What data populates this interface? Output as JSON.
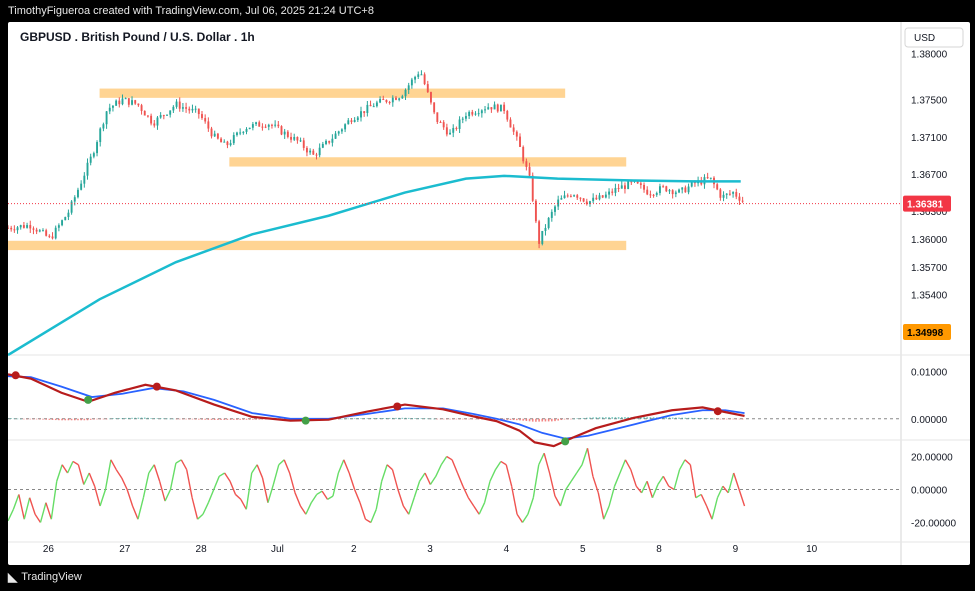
{
  "header": {
    "attribution": "TimothyFigueroa created with TradingView.com, Jul 06, 2025 21:24 UTC+8"
  },
  "footer": {
    "logo_text": "TradingView"
  },
  "colors": {
    "up": "#26a69a",
    "down": "#ef5350",
    "ma": "#1bbccf",
    "zone": "#ffcc80",
    "macd_fast": "#b71c1c",
    "macd_slow": "#2962ff",
    "macd_cross_up": "#43a047",
    "osc_up": "#66dd66",
    "osc_down": "#ef5350",
    "price_label": "#f23645",
    "marker_label": "#ff9800"
  },
  "chart_data": {
    "type": "candlestick",
    "title": "GBPUSD . British Pound / U.S. Dollar . 1h",
    "currency": "USD",
    "price_axis": {
      "ticks": [
        "1.38000",
        "1.37500",
        "1.37100",
        "1.36700",
        "1.36300",
        "1.36000",
        "1.35700",
        "1.35400"
      ],
      "ylim": [
        1.3475,
        1.381
      ]
    },
    "x_axis": {
      "labels": [
        "26",
        "27",
        "28",
        "Jul",
        "2",
        "3",
        "4",
        "5",
        "8",
        "9",
        "10"
      ],
      "day_range": [
        25.3,
        37.0
      ]
    },
    "last_price": "1.36381",
    "marker_price": "1.34998",
    "moving_average": {
      "points": [
        [
          25.3,
          1.3475
        ],
        [
          26.5,
          1.3535
        ],
        [
          27.5,
          1.3575
        ],
        [
          28.5,
          1.3605
        ],
        [
          29.5,
          1.3625
        ],
        [
          30.5,
          1.365
        ],
        [
          31.3,
          1.3665
        ],
        [
          31.8,
          1.3668
        ],
        [
          32.5,
          1.3665
        ],
        [
          33.5,
          1.3663
        ],
        [
          34.3,
          1.3662
        ],
        [
          34.9,
          1.3662
        ]
      ]
    },
    "zones": [
      {
        "from_day": 26.5,
        "to_day": 32.6,
        "low": 1.3752,
        "high": 1.3762
      },
      {
        "from_day": 28.2,
        "to_day": 33.4,
        "low": 1.3678,
        "high": 1.3688
      },
      {
        "from_day": 25.3,
        "to_day": 33.4,
        "low": 1.3588,
        "high": 1.3598
      }
    ],
    "price_anchors": [
      [
        25.3,
        1.3612
      ],
      [
        25.6,
        1.3615
      ],
      [
        25.85,
        1.36
      ],
      [
        26.1,
        1.363
      ],
      [
        26.4,
        1.369
      ],
      [
        26.6,
        1.374
      ],
      [
        26.8,
        1.375
      ],
      [
        27.0,
        1.3745
      ],
      [
        27.2,
        1.3725
      ],
      [
        27.5,
        1.3745
      ],
      [
        27.8,
        1.3735
      ],
      [
        28.0,
        1.371
      ],
      [
        28.15,
        1.37
      ],
      [
        28.4,
        1.372
      ],
      [
        28.7,
        1.3725
      ],
      [
        28.9,
        1.3715
      ],
      [
        29.1,
        1.3705
      ],
      [
        29.3,
        1.369
      ],
      [
        29.5,
        1.3705
      ],
      [
        29.8,
        1.373
      ],
      [
        30.1,
        1.3745
      ],
      [
        30.45,
        1.3755
      ],
      [
        30.7,
        1.3782
      ],
      [
        30.9,
        1.373
      ],
      [
        31.1,
        1.3712
      ],
      [
        31.3,
        1.3735
      ],
      [
        31.6,
        1.3743
      ],
      [
        31.8,
        1.374
      ],
      [
        32.0,
        1.37
      ],
      [
        32.15,
        1.366
      ],
      [
        32.25,
        1.3595
      ],
      [
        32.35,
        1.3615
      ],
      [
        32.5,
        1.364
      ],
      [
        32.7,
        1.365
      ],
      [
        32.9,
        1.364
      ],
      [
        33.1,
        1.3645
      ],
      [
        33.3,
        1.3655
      ],
      [
        33.5,
        1.366
      ],
      [
        33.7,
        1.365
      ],
      [
        33.9,
        1.3655
      ],
      [
        34.1,
        1.365
      ],
      [
        34.3,
        1.366
      ],
      [
        34.5,
        1.3665
      ],
      [
        34.65,
        1.3645
      ],
      [
        34.8,
        1.365
      ],
      [
        34.95,
        1.364
      ]
    ],
    "macd": {
      "ticks": [
        "0.01000",
        "0.00000"
      ],
      "ylim": [
        -0.0045,
        0.0135
      ],
      "fast": [
        [
          25.3,
          0.0094
        ],
        [
          25.6,
          0.0085
        ],
        [
          26.0,
          0.0055
        ],
        [
          26.35,
          0.0036
        ],
        [
          26.7,
          0.0055
        ],
        [
          27.1,
          0.0072
        ],
        [
          27.5,
          0.006
        ],
        [
          28.0,
          0.003
        ],
        [
          28.5,
          0.0004
        ],
        [
          29.0,
          -0.0004
        ],
        [
          29.5,
          -0.0002
        ],
        [
          30.0,
          0.0015
        ],
        [
          30.5,
          0.003
        ],
        [
          31.0,
          0.002
        ],
        [
          31.4,
          0.0005
        ],
        [
          31.7,
          -0.0005
        ],
        [
          32.0,
          -0.0025
        ],
        [
          32.2,
          -0.005
        ],
        [
          32.45,
          -0.0058
        ],
        [
          32.7,
          -0.004
        ],
        [
          33.0,
          -0.002
        ],
        [
          33.5,
          0.0002
        ],
        [
          34.0,
          0.0018
        ],
        [
          34.4,
          0.0024
        ],
        [
          34.7,
          0.0014
        ],
        [
          34.95,
          0.0006
        ]
      ],
      "slow": [
        [
          25.3,
          0.009
        ],
        [
          25.6,
          0.0088
        ],
        [
          26.0,
          0.0068
        ],
        [
          26.4,
          0.0046
        ],
        [
          26.8,
          0.0053
        ],
        [
          27.2,
          0.0065
        ],
        [
          27.6,
          0.0058
        ],
        [
          28.0,
          0.004
        ],
        [
          28.5,
          0.0012
        ],
        [
          29.0,
          0.0
        ],
        [
          29.5,
          0.0
        ],
        [
          30.0,
          0.001
        ],
        [
          30.5,
          0.0022
        ],
        [
          31.0,
          0.0022
        ],
        [
          31.4,
          0.001
        ],
        [
          31.7,
          0.0
        ],
        [
          32.0,
          -0.0012
        ],
        [
          32.3,
          -0.003
        ],
        [
          32.6,
          -0.0042
        ],
        [
          32.9,
          -0.0036
        ],
        [
          33.2,
          -0.0024
        ],
        [
          33.6,
          -0.0008
        ],
        [
          34.0,
          0.0008
        ],
        [
          34.4,
          0.0018
        ],
        [
          34.7,
          0.0018
        ],
        [
          34.95,
          0.0012
        ]
      ],
      "crosses": [
        {
          "day": 25.4,
          "value": 0.0092,
          "kind": "down"
        },
        {
          "day": 26.35,
          "value": 0.004,
          "kind": "up"
        },
        {
          "day": 27.25,
          "value": 0.0068,
          "kind": "down"
        },
        {
          "day": 29.2,
          "value": -0.0004,
          "kind": "up"
        },
        {
          "day": 30.4,
          "value": 0.0026,
          "kind": "down"
        },
        {
          "day": 32.6,
          "value": -0.0048,
          "kind": "up"
        },
        {
          "day": 34.6,
          "value": 0.0016,
          "kind": "down"
        }
      ]
    },
    "oscillator": {
      "ticks": [
        "20.00000",
        "0.00000",
        "-20.00000"
      ],
      "ylim": [
        -30,
        30
      ],
      "values": [
        -19,
        -12,
        -3,
        -18,
        -5,
        -15,
        -20,
        -8,
        -18,
        5,
        15,
        10,
        17,
        15,
        3,
        10,
        2,
        -10,
        0,
        18,
        12,
        7,
        0,
        -10,
        -18,
        -5,
        10,
        15,
        5,
        -7,
        0,
        16,
        18,
        12,
        -5,
        -18,
        -15,
        -8,
        0,
        8,
        10,
        5,
        -3,
        -6,
        -12,
        10,
        15,
        7,
        -8,
        3,
        15,
        18,
        10,
        -2,
        -10,
        -15,
        -8,
        -3,
        -1,
        -6,
        -4,
        10,
        18,
        10,
        0,
        -8,
        -18,
        -20,
        -12,
        5,
        15,
        12,
        0,
        -10,
        -15,
        -5,
        5,
        10,
        3,
        8,
        15,
        20,
        18,
        10,
        2,
        -5,
        -10,
        -15,
        -8,
        5,
        12,
        17,
        15,
        2,
        -15,
        -20,
        -15,
        -5,
        15,
        22,
        10,
        -4,
        -10,
        0,
        5,
        10,
        15,
        25,
        8,
        -2,
        -18,
        -10,
        2,
        10,
        18,
        12,
        2,
        -2,
        5,
        -5,
        3,
        8,
        2,
        0,
        12,
        18,
        15,
        -5,
        -3,
        -10,
        -18,
        -5,
        2,
        -2,
        10,
        0,
        -10
      ]
    }
  }
}
